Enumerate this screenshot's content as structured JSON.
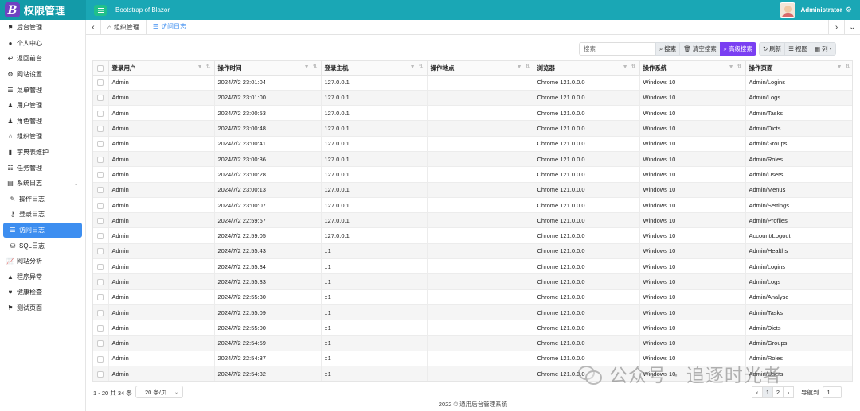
{
  "header": {
    "logo_letter": "B",
    "brand": "权限管理",
    "subtitle": "Bootstrap of Blazor",
    "user_name": "Administrator"
  },
  "sidebar": {
    "items": [
      {
        "label": "后台管理",
        "icon": "flag-icon"
      },
      {
        "label": "个人中心",
        "icon": "user-icon"
      },
      {
        "label": "返回前台",
        "icon": "reply-icon"
      },
      {
        "label": "网站设置",
        "icon": "gear-icon"
      },
      {
        "label": "菜单管理",
        "icon": "list-icon"
      },
      {
        "label": "用户管理",
        "icon": "user-plus-icon"
      },
      {
        "label": "角色管理",
        "icon": "users-icon"
      },
      {
        "label": "组织管理",
        "icon": "sitemap-icon"
      },
      {
        "label": "字典表维护",
        "icon": "book-icon"
      },
      {
        "label": "任务管理",
        "icon": "tasks-icon"
      },
      {
        "label": "系统日志",
        "icon": "log-icon"
      },
      {
        "label": "操作日志",
        "icon": "edit-icon"
      },
      {
        "label": "登录日志",
        "icon": "key-icon"
      },
      {
        "label": "访问日志",
        "icon": "list-icon"
      },
      {
        "label": "SQL日志",
        "icon": "database-icon"
      },
      {
        "label": "网站分析",
        "icon": "chart-icon"
      },
      {
        "label": "程序异常",
        "icon": "bug-icon"
      },
      {
        "label": "健康检查",
        "icon": "heartbeat-icon"
      },
      {
        "label": "测试页面",
        "icon": "flag-icon"
      }
    ]
  },
  "tabs": [
    {
      "label": "组织管理",
      "icon": "sitemap-icon"
    },
    {
      "label": "访问日志",
      "icon": "list-icon"
    }
  ],
  "toolbar": {
    "search_placeholder": "搜索",
    "search_btn": "搜索",
    "clear_btn": "清空搜索",
    "advanced_btn": "高级搜索",
    "refresh_btn": "刷新",
    "view_btn": "视图",
    "columns_btn": "列"
  },
  "table": {
    "columns": [
      "登录用户",
      "操作时间",
      "登录主机",
      "操作地点",
      "浏览器",
      "操作系统",
      "操作页面"
    ],
    "rows": [
      [
        "Admin",
        "2024/7/2 23:01:04",
        "127.0.0.1",
        "",
        "Chrome 121.0.0.0",
        "Windows 10",
        "Admin/Logins"
      ],
      [
        "Admin",
        "2024/7/2 23:01:00",
        "127.0.0.1",
        "",
        "Chrome 121.0.0.0",
        "Windows 10",
        "Admin/Logs"
      ],
      [
        "Admin",
        "2024/7/2 23:00:53",
        "127.0.0.1",
        "",
        "Chrome 121.0.0.0",
        "Windows 10",
        "Admin/Tasks"
      ],
      [
        "Admin",
        "2024/7/2 23:00:48",
        "127.0.0.1",
        "",
        "Chrome 121.0.0.0",
        "Windows 10",
        "Admin/Dicts"
      ],
      [
        "Admin",
        "2024/7/2 23:00:41",
        "127.0.0.1",
        "",
        "Chrome 121.0.0.0",
        "Windows 10",
        "Admin/Groups"
      ],
      [
        "Admin",
        "2024/7/2 23:00:36",
        "127.0.0.1",
        "",
        "Chrome 121.0.0.0",
        "Windows 10",
        "Admin/Roles"
      ],
      [
        "Admin",
        "2024/7/2 23:00:28",
        "127.0.0.1",
        "",
        "Chrome 121.0.0.0",
        "Windows 10",
        "Admin/Users"
      ],
      [
        "Admin",
        "2024/7/2 23:00:13",
        "127.0.0.1",
        "",
        "Chrome 121.0.0.0",
        "Windows 10",
        "Admin/Menus"
      ],
      [
        "Admin",
        "2024/7/2 23:00:07",
        "127.0.0.1",
        "",
        "Chrome 121.0.0.0",
        "Windows 10",
        "Admin/Settings"
      ],
      [
        "Admin",
        "2024/7/2 22:59:57",
        "127.0.0.1",
        "",
        "Chrome 121.0.0.0",
        "Windows 10",
        "Admin/Profiles"
      ],
      [
        "Admin",
        "2024/7/2 22:59:05",
        "127.0.0.1",
        "",
        "Chrome 121.0.0.0",
        "Windows 10",
        "Account/Logout"
      ],
      [
        "Admin",
        "2024/7/2 22:55:43",
        "::1",
        "",
        "Chrome 121.0.0.0",
        "Windows 10",
        "Admin/Healths"
      ],
      [
        "Admin",
        "2024/7/2 22:55:34",
        "::1",
        "",
        "Chrome 121.0.0.0",
        "Windows 10",
        "Admin/Logins"
      ],
      [
        "Admin",
        "2024/7/2 22:55:33",
        "::1",
        "",
        "Chrome 121.0.0.0",
        "Windows 10",
        "Admin/Logs"
      ],
      [
        "Admin",
        "2024/7/2 22:55:30",
        "::1",
        "",
        "Chrome 121.0.0.0",
        "Windows 10",
        "Admin/Analyse"
      ],
      [
        "Admin",
        "2024/7/2 22:55:09",
        "::1",
        "",
        "Chrome 121.0.0.0",
        "Windows 10",
        "Admin/Tasks"
      ],
      [
        "Admin",
        "2024/7/2 22:55:00",
        "::1",
        "",
        "Chrome 121.0.0.0",
        "Windows 10",
        "Admin/Dicts"
      ],
      [
        "Admin",
        "2024/7/2 22:54:59",
        "::1",
        "",
        "Chrome 121.0.0.0",
        "Windows 10",
        "Admin/Groups"
      ],
      [
        "Admin",
        "2024/7/2 22:54:37",
        "::1",
        "",
        "Chrome 121.0.0.0",
        "Windows 10",
        "Admin/Roles"
      ],
      [
        "Admin",
        "2024/7/2 22:54:32",
        "::1",
        "",
        "Chrome 121.0.0.0",
        "Windows 10",
        "Admin/Users"
      ]
    ]
  },
  "pagination": {
    "info": "1 - 20 共 34 条",
    "page_size": "20 条/页",
    "prev": "‹",
    "pages": [
      "1",
      "2"
    ],
    "next": "›",
    "goto_label": "导航到",
    "goto_value": "1"
  },
  "footer": "2022 © 通用后台管理系统",
  "watermark": "公众号 · 追逐时光者",
  "colors": {
    "header": "#1aa7b5",
    "active_nav": "#3d8ef0",
    "advanced_btn": "#7a3ff2"
  }
}
